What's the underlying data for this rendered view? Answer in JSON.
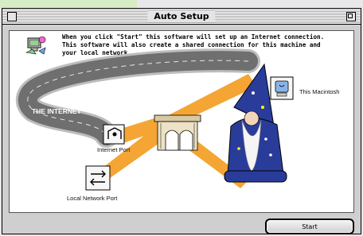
{
  "window": {
    "title": "Auto Setup"
  },
  "intro": {
    "line1": "When you click \"Start\" this software will set up an Internet connection.",
    "line2": "This software will also create a shared connection for this machine and",
    "line3": "your local network."
  },
  "diagram": {
    "internet_label": "THE INTERNET",
    "internet_port_label": "Internet Port",
    "local_port_label": "Local Network Port",
    "mac_label": "This Macintosh"
  },
  "buttons": {
    "start_label": "Start"
  },
  "colors": {
    "link_orange": "#f4a533",
    "highway_gray": "#7a7a7a"
  }
}
